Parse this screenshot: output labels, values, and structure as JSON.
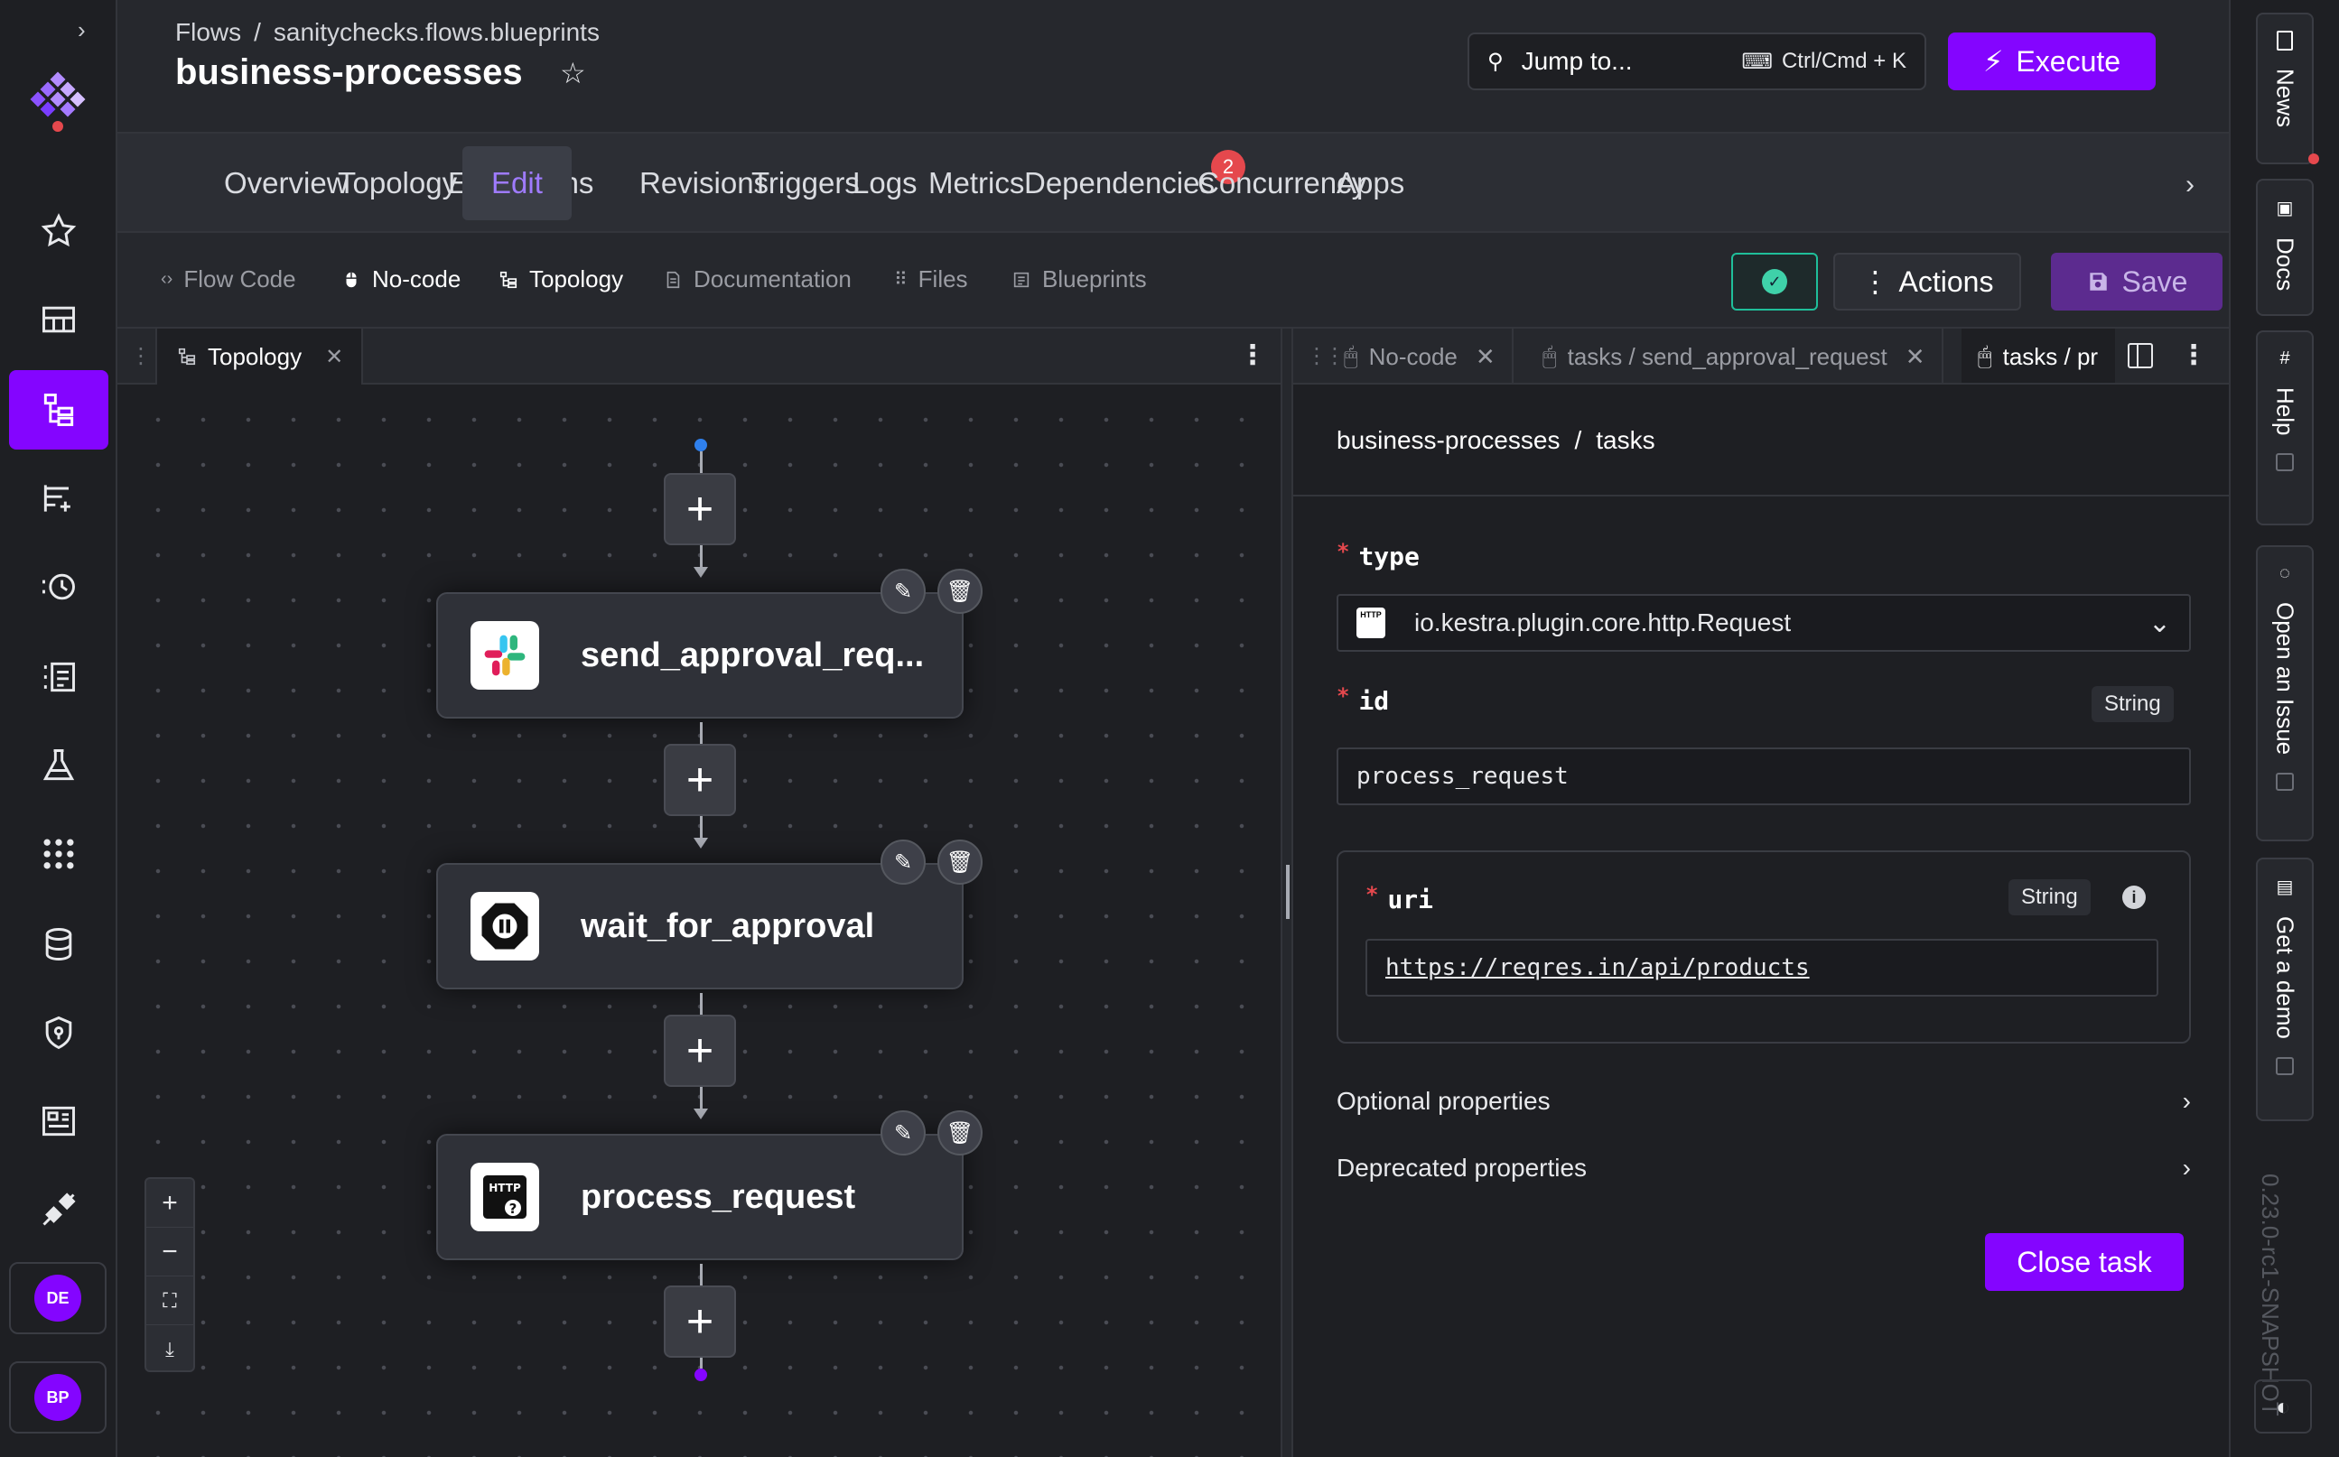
{
  "breadcrumb": {
    "root": "Flows",
    "namespace": "sanitychecks.flows.blueprints"
  },
  "page_title": "business-processes",
  "jump": {
    "label": "Jump to...",
    "shortcut": "Ctrl/Cmd + K"
  },
  "execute_label": "Execute",
  "tabs": [
    {
      "label": "Overview"
    },
    {
      "label": "Topology"
    },
    {
      "label": "Executions"
    },
    {
      "label": "Edit",
      "active": true
    },
    {
      "label": "Revisions"
    },
    {
      "label": "Triggers"
    },
    {
      "label": "Logs"
    },
    {
      "label": "Metrics"
    },
    {
      "label": "Dependencies",
      "badge": "2"
    },
    {
      "label": "Concurrency"
    },
    {
      "label": "Apps"
    }
  ],
  "views": {
    "flow_code": "Flow Code",
    "no_code": "No-code",
    "topology": "Topology",
    "documentation": "Documentation",
    "files": "Files",
    "blueprints": "Blueprints"
  },
  "toolbar": {
    "actions_label": "Actions",
    "save_label": "Save"
  },
  "left_pane": {
    "tab_label": "Topology"
  },
  "topology": {
    "nodes": [
      {
        "name": "send_approval_req...",
        "icon": "slack-icon"
      },
      {
        "name": "wait_for_approval",
        "icon": "pause-icon"
      },
      {
        "name": "process_request",
        "icon": "http-icon"
      }
    ]
  },
  "right_pane": {
    "tabs": [
      {
        "label": "No-code"
      },
      {
        "label": "tasks / send_approval_request"
      },
      {
        "label": "tasks / pr"
      }
    ],
    "path": {
      "flow": "business-processes",
      "section": "tasks"
    },
    "fields": {
      "type": {
        "label": "type",
        "value": "io.kestra.plugin.core.http.Request"
      },
      "id": {
        "label": "id",
        "type": "String",
        "value": "process_request"
      },
      "uri": {
        "label": "uri",
        "type": "String",
        "value": "https://reqres.in/api/products"
      }
    },
    "optional_label": "Optional properties",
    "deprecated_label": "Deprecated properties",
    "close_label": "Close task"
  },
  "users": [
    "DE",
    "BP"
  ],
  "right_sidebar": {
    "news": "News",
    "docs": "Docs",
    "help": "Help",
    "issue": "Open an Issue",
    "demo": "Get a demo"
  },
  "version": "0.23.0-rc1-SNAPSHOT",
  "colors": {
    "accent": "#8405ff",
    "active_tab": "#9f7bff",
    "valid": "#3fd1a9",
    "badge": "#e5484d"
  }
}
